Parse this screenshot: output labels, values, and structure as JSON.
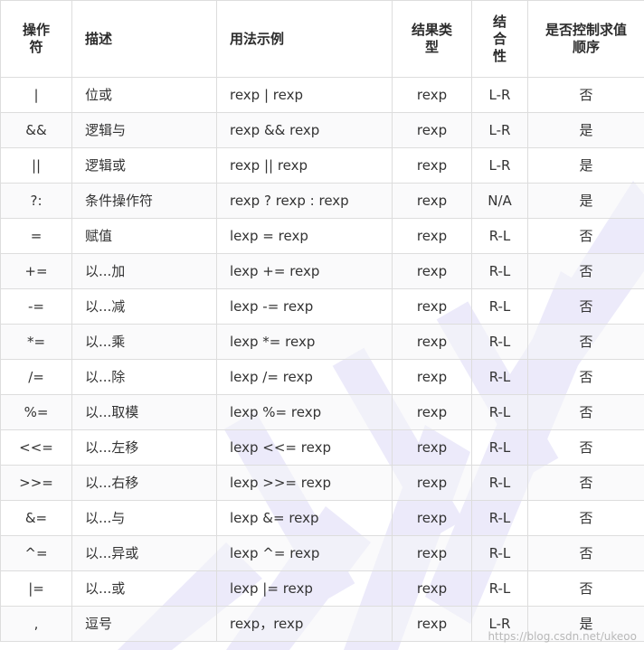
{
  "headers": [
    "操作\n符",
    "描述",
    "用法示例",
    "结果类\n型",
    "结\n合\n性",
    "是否控制求值\n顺序"
  ],
  "rows": [
    [
      "|",
      "位或",
      "rexp | rexp",
      "rexp",
      "L-R",
      "否"
    ],
    [
      "&&",
      "逻辑与",
      "rexp && rexp",
      "rexp",
      "L-R",
      "是"
    ],
    [
      "||",
      "逻辑或",
      "rexp || rexp",
      "rexp",
      "L-R",
      "是"
    ],
    [
      "?:",
      "条件操作符",
      "rexp ? rexp : rexp",
      "rexp",
      "N/A",
      "是"
    ],
    [
      "=",
      "赋值",
      "lexp = rexp",
      "rexp",
      "R-L",
      "否"
    ],
    [
      "+=",
      "以...加",
      "lexp += rexp",
      "rexp",
      "R-L",
      "否"
    ],
    [
      "-=",
      "以...减",
      "lexp -= rexp",
      "rexp",
      "R-L",
      "否"
    ],
    [
      "*=",
      "以...乘",
      "lexp *= rexp",
      "rexp",
      "R-L",
      "否"
    ],
    [
      "/=",
      "以...除",
      "lexp /= rexp",
      "rexp",
      "R-L",
      "否"
    ],
    [
      "%=",
      "以...取模",
      "lexp %= rexp",
      "rexp",
      "R-L",
      "否"
    ],
    [
      "<<=",
      "以...左移",
      "lexp <<= rexp",
      "rexp",
      "R-L",
      "否"
    ],
    [
      ">>=",
      "以...右移",
      "lexp >>= rexp",
      "rexp",
      "R-L",
      "否"
    ],
    [
      "&=",
      "以...与",
      "lexp &= rexp",
      "rexp",
      "R-L",
      "否"
    ],
    [
      "^=",
      "以...异或",
      "lexp ^= rexp",
      "rexp",
      "R-L",
      "否"
    ],
    [
      "|=",
      "以...或",
      "lexp |= rexp",
      "rexp",
      "R-L",
      "否"
    ],
    [
      ",",
      "逗号",
      "rexp，rexp",
      "rexp",
      "L-R",
      "是"
    ]
  ],
  "footer_text": "https://blog.csdn.net/ukeoo",
  "colors": {
    "border": "#dddddd",
    "text": "#333333",
    "watermark": "#e4e3f8"
  }
}
